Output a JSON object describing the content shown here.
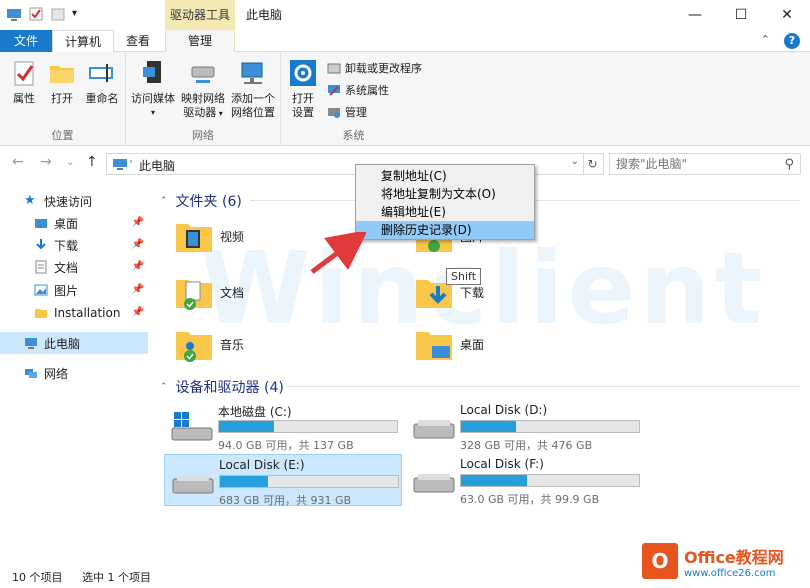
{
  "titlebar": {
    "drive_tools": "驱动器工具",
    "title": "此电脑"
  },
  "tabs": {
    "file": "文件",
    "computer": "计算机",
    "view": "查看",
    "manage": "管理"
  },
  "ribbon": {
    "location": {
      "label": "位置",
      "properties": "属性",
      "open": "打开",
      "rename": "重命名"
    },
    "network": {
      "label": "网络",
      "access_media": "访问媒体",
      "map_drive_1": "映射网络",
      "map_drive_2": "驱动器",
      "add_location_1": "添加一个",
      "add_location_2": "网络位置"
    },
    "system": {
      "label": "系统",
      "open_settings_1": "打开",
      "open_settings_2": "设置",
      "uninstall": "卸载或更改程序",
      "system_props": "系统属性",
      "manage": "管理"
    }
  },
  "address": {
    "path": "此电脑",
    "search_placeholder": "搜索\"此电脑\""
  },
  "sidebar": {
    "quick_access": "快速访问",
    "items": [
      {
        "label": "桌面"
      },
      {
        "label": "下载"
      },
      {
        "label": "文档"
      },
      {
        "label": "图片"
      },
      {
        "label": "Installation"
      }
    ],
    "this_pc": "此电脑",
    "network": "网络"
  },
  "folders": {
    "title": "文件夹 (6)",
    "items": [
      {
        "label": "视频"
      },
      {
        "label": "图片"
      },
      {
        "label": "文档"
      },
      {
        "label": "下载"
      },
      {
        "label": "音乐"
      },
      {
        "label": "桌面"
      }
    ]
  },
  "drives": {
    "title": "设备和驱动器 (4)",
    "items": [
      {
        "name": "本地磁盘 (C:)",
        "info": "94.0 GB 可用，共 137 GB",
        "used_fraction": 0.31
      },
      {
        "name": "Local Disk (D:)",
        "info": "328 GB 可用，共 476 GB",
        "used_fraction": 0.31
      },
      {
        "name": "Local Disk (E:)",
        "info": "683 GB 可用，共 931 GB",
        "used_fraction": 0.27
      },
      {
        "name": "Local Disk (F:)",
        "info": "63.0 GB 可用，共 99.9 GB",
        "used_fraction": 0.37
      }
    ]
  },
  "context_menu": {
    "items": [
      {
        "label": "复制地址(C)"
      },
      {
        "label": "将地址复制为文本(O)"
      },
      {
        "label": "编辑地址(E)"
      },
      {
        "label": "删除历史记录(D)"
      }
    ]
  },
  "tooltip": "Shift",
  "watermark": "Winclient",
  "status": {
    "count": "10 个项目",
    "selected": "选中 1 个项目"
  },
  "brand": {
    "name": "Office教程网",
    "url": "www.office26.com"
  },
  "colors": {
    "accent": "#1979ca",
    "drive_fill": "#26a0da",
    "selection": "#cce8ff",
    "brand": "#e8541e"
  }
}
